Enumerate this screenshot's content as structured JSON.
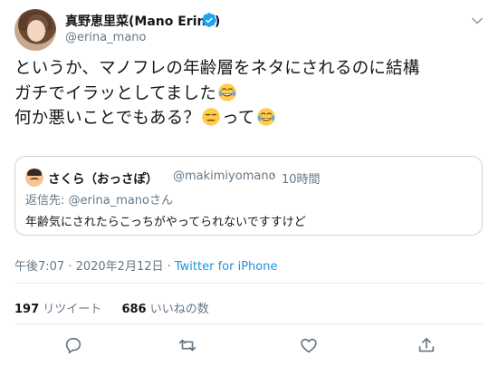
{
  "user": {
    "display_name": "真野恵里菜(Mano Erina)",
    "handle": "@erina_mano",
    "verified": true
  },
  "tweet": {
    "line1": "というか、マノフレの年齢層をネタにされるのに結構",
    "line2": "ガチでイラッとしてました",
    "line3a": "何か悪いことでもある？",
    "line3b": "って"
  },
  "quote": {
    "name": "さくら（おっさぽ）",
    "handle": "@makimiyomano",
    "separator": "·",
    "time": "10時間",
    "reply_prefix": "返信先: ",
    "reply_to": "@erina_mano",
    "reply_suffix": "さん",
    "text": "年齢気にされたらこっちがやってられないですすけど"
  },
  "meta": {
    "timestamp": "午後7:07 · 2020年2月12日 · ",
    "source": "Twitter for iPhone"
  },
  "stats": {
    "retweets": "197",
    "retweets_label": "リツイート",
    "likes": "686",
    "likes_label": "いいねの数"
  },
  "colors": {
    "accent": "#1b95e0",
    "muted": "#657786",
    "border": "#e6ecf0"
  },
  "icons": [
    "verified-badge-icon",
    "chevron-down-icon",
    "tears-of-joy-emoji",
    "expressionless-emoji",
    "reply-icon",
    "retweet-icon",
    "like-icon",
    "share-icon"
  ]
}
